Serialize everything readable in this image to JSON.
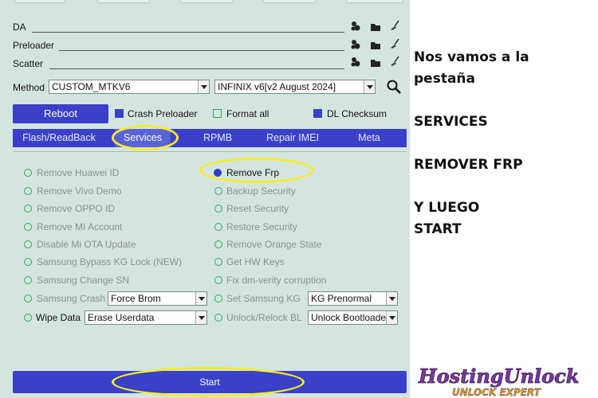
{
  "fields": {
    "da": {
      "label": "DA"
    },
    "preloader": {
      "label": "Preloader"
    },
    "scatter": {
      "label": "Scatter"
    }
  },
  "method": {
    "label": "Method",
    "value": "CUSTOM_MTKV6",
    "device_value": "INFINIX v6[v2 August 2024]"
  },
  "reboot_label": "Reboot",
  "checks": {
    "crash_preloader": {
      "label": "Crash Preloader",
      "checked": true
    },
    "format_all": {
      "label": "Format all",
      "checked": false
    },
    "dl_checksum": {
      "label": "DL Checksum",
      "checked": true
    }
  },
  "tabs": [
    "Flash/ReadBack",
    "Services",
    "RPMB",
    "Repair IMEI",
    "Meta"
  ],
  "active_tab": "Services",
  "options_left": [
    "Remove Huawei ID",
    "Remove Vivo Demo",
    "Remove OPPO ID",
    "Remove MI Account",
    "Disable Mi OTA Update",
    "Samsung Bypass KG Lock (NEW)",
    "Samsung Change SN",
    "Samsung Crash",
    "Wipe Data"
  ],
  "options_right": [
    "Remove Frp",
    "Backup Security",
    "Reset Security",
    "Restore Security",
    "Remove Orange State",
    "Get HW Keys",
    "Fix dm-verity corruption",
    "Set Samsung KG",
    "Unlock/Relock BL"
  ],
  "selected_option": "Remove Frp",
  "combos": {
    "samsung_crash": "Force Brom",
    "wipe_data": "Erase Userdata",
    "set_samsung_kg": "KG Prenormal",
    "unlock_relock": "Unlock Bootloade"
  },
  "start_label": "Start",
  "instructions": {
    "line1": "Nos vamos a la",
    "line2": "pestaña",
    "line3": "SERVICES",
    "line4": "REMOVER FRP",
    "line5": "Y LUEGO",
    "line6": "START"
  },
  "logo": {
    "text_main": "HostingUnlock",
    "text_sub": "UNLOCK EXPERT"
  },
  "colors": {
    "panel_bg": "#d4e5e0",
    "accent_blue": "#3a40c7",
    "highlight_ring": "#f5ec2a",
    "radio_green": "#2fa36a"
  }
}
